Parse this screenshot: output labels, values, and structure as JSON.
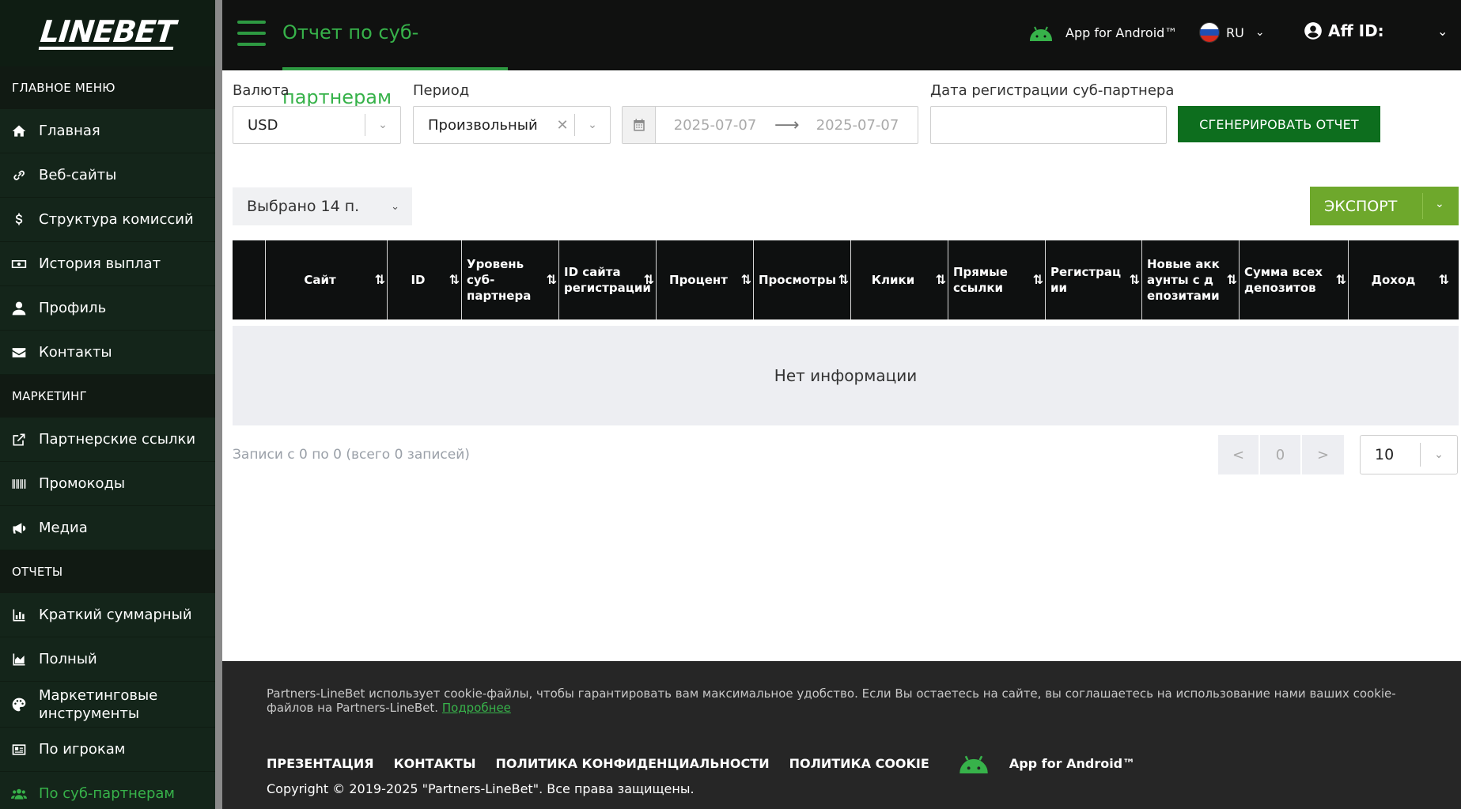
{
  "brand": {
    "logo": "LINEBET"
  },
  "sidebar": {
    "main_title": "ГЛАВНОЕ МЕНЮ",
    "main_items": [
      {
        "label": "Главная",
        "icon": "home-icon"
      },
      {
        "label": "Веб-сайты",
        "icon": "link-icon"
      },
      {
        "label": "Структура комиссий",
        "icon": "dollar-icon"
      },
      {
        "label": "История выплат",
        "icon": "money-icon"
      },
      {
        "label": "Профиль",
        "icon": "user-icon"
      },
      {
        "label": "Контакты",
        "icon": "envelope-icon"
      }
    ],
    "marketing_title": "МАРКЕТИНГ",
    "marketing_items": [
      {
        "label": "Партнерские ссылки",
        "icon": "external-link-icon"
      },
      {
        "label": "Промокоды",
        "icon": "barcode-icon"
      },
      {
        "label": "Медиа",
        "icon": "megaphone-icon"
      }
    ],
    "reports_title": "ОТЧЕТЫ",
    "reports_items": [
      {
        "label": "Краткий суммарный",
        "icon": "bar-chart-icon"
      },
      {
        "label": "Полный",
        "icon": "area-chart-icon"
      },
      {
        "label": "Маркетинговые инструменты",
        "icon": "palette-icon"
      },
      {
        "label": "По игрокам",
        "icon": "id-card-icon"
      },
      {
        "label": "По суб-партнерам",
        "icon": "users-icon"
      }
    ]
  },
  "header": {
    "title": "Отчет по суб-партнерам",
    "android_label": "App for Android™",
    "language": "RU",
    "aff_label": "Aff ID:"
  },
  "filters": {
    "currency_label": "Валюта",
    "currency_value": "USD",
    "period_label": "Период",
    "period_value": "Произвольный",
    "date_from": "2025-07-07",
    "date_to": "2025-07-07",
    "reg_date_label": "Дата регистрации суб-партнера",
    "reg_date_value": "",
    "generate_label": "СГЕНЕРИРОВАТЬ ОТЧЕТ"
  },
  "toolbar": {
    "selected_label": "Выбрано 14 п.",
    "export_label": "ЭКСПОРТ"
  },
  "table": {
    "columns": [
      "",
      "Сайт",
      "ID",
      "Уровень суб-партнера",
      "ID сайта регистрации",
      "Процент",
      "Просмотры",
      "Клики",
      "Прямые ссылки",
      "Регистрации",
      "Новые аккаунты с депозитами",
      "Сумма всех депозитов",
      "Доход"
    ],
    "empty_text": "Нет информации"
  },
  "pagination": {
    "records_text": "Записи с 0 по 0 (всего 0 записей)",
    "prev": "<",
    "current": "0",
    "next": ">",
    "page_size": "10"
  },
  "footer": {
    "cookie_text": "Partners-LineBet использует cookie-файлы, чтобы гарантировать вам максимальное удобство. Если Вы остаетесь на сайте, вы соглашаетесь на использование нами ваших cookie-файлов на Partners-LineBet.",
    "cookie_link": "Подробнее",
    "links": [
      "ПРЕЗЕНТАЦИЯ",
      "КОНТАКТЫ",
      "ПОЛИТИКА КОНФИДЕНЦИАЛЬНОСТИ",
      "ПОЛИТИКА COOKIE"
    ],
    "android_label": "App for Android™",
    "copyright": "Copyright © 2019-2025 \"Partners-LineBet\". Все права защищены."
  },
  "colors": {
    "accent_green": "#37b24a",
    "button_green": "#0d6e1e",
    "export_green": "#6ea82c",
    "sidebar_bg": "#14251a",
    "header_bg": "#101110"
  }
}
